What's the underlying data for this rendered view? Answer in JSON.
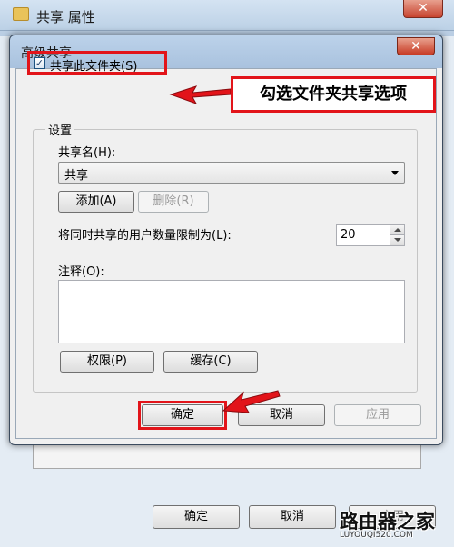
{
  "background_window": {
    "title": "共享 属性",
    "close_glyph": "✕",
    "buttons": {
      "ok": "确定",
      "cancel": "取消",
      "apply": "应用"
    }
  },
  "dialog": {
    "title": "高级共享",
    "close_glyph": "✕",
    "share_checkbox": {
      "label": "共享此文件夹(S)",
      "checked": true,
      "check_glyph": "✓"
    },
    "settings": {
      "group_label": "设置",
      "share_name_label": "共享名(H):",
      "share_name_value": "共享",
      "add_button": "添加(A)",
      "remove_button": "删除(R)",
      "user_limit_label": "将同时共享的用户数量限制为(L):",
      "user_limit_value": "20",
      "comments_label": "注释(O):",
      "comments_value": "",
      "permissions_button": "权限(P)",
      "caching_button": "缓存(C)"
    },
    "buttons": {
      "ok": "确定",
      "cancel": "取消",
      "apply": "应用"
    }
  },
  "annotation": {
    "text": "勾选文件夹共享选项",
    "color": "#e2141a"
  },
  "watermark": {
    "main": "路由器之家",
    "sub": "LUYOUQI520.COM"
  }
}
